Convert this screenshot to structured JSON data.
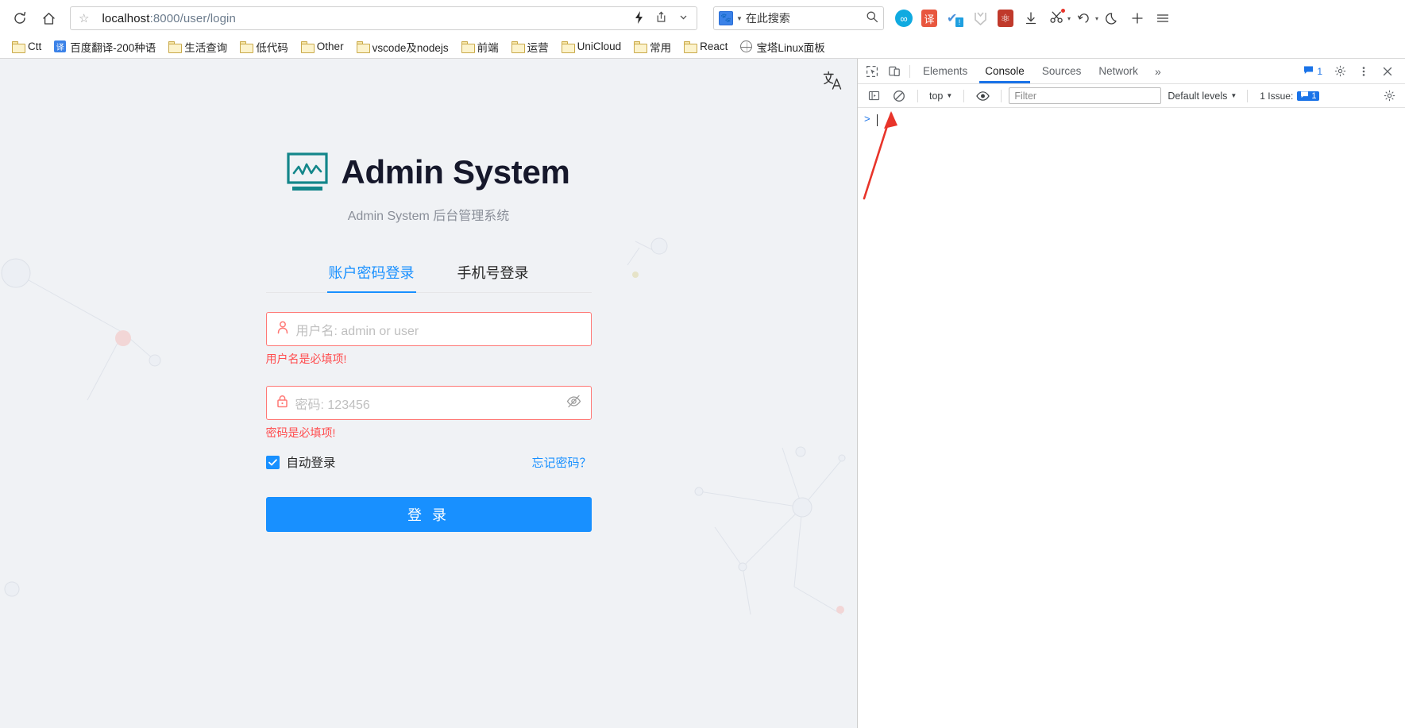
{
  "browser": {
    "nav": {
      "reload_icon": "reload-icon",
      "home_icon": "home-icon"
    },
    "omnibox": {
      "star_icon": "bookmark-star-icon",
      "url_host": "localhost",
      "url_path": ":8000/user/login",
      "lightning_icon": "lightning-icon",
      "share_icon": "share-icon",
      "chevron_icon": "chevron-down-icon"
    },
    "search": {
      "engine_icon": "baidu-paw-icon",
      "placeholder": "在此搜索",
      "search_icon": "search-icon"
    },
    "toolbar_icons": [
      {
        "name": "infinity-extension-icon",
        "glyph": "∞",
        "color": "#1aa3e8"
      },
      {
        "name": "translate-extension-icon",
        "glyph": "译",
        "color": "#e8573f"
      },
      {
        "name": "check-extension-icon",
        "glyph": "✔",
        "color": "#4a90d9"
      },
      {
        "name": "download-manager-icon",
        "glyph": "M",
        "color": "#bdbdbd"
      },
      {
        "name": "atom-extension-icon",
        "glyph": "⚛",
        "color": "#c0392b"
      },
      {
        "name": "downloads-icon",
        "glyph": "↓",
        "color": "#444"
      },
      {
        "name": "screenshot-scissors-icon",
        "glyph": "✂",
        "color": "#444"
      },
      {
        "name": "history-back-icon",
        "glyph": "↺",
        "color": "#444"
      },
      {
        "name": "dark-mode-moon-icon",
        "glyph": "☾",
        "color": "#444"
      },
      {
        "name": "new-tab-plus-icon",
        "glyph": "+",
        "color": "#444"
      },
      {
        "name": "main-menu-icon",
        "glyph": "☰",
        "color": "#444"
      }
    ],
    "bookmarks": [
      {
        "label": "Ctt",
        "icon": "folder-icon"
      },
      {
        "label": "百度翻译-200种语",
        "icon": "translate-favicon"
      },
      {
        "label": "生活查询",
        "icon": "folder-icon"
      },
      {
        "label": "低代码",
        "icon": "folder-icon"
      },
      {
        "label": "Other",
        "icon": "folder-icon"
      },
      {
        "label": "vscode及nodejs",
        "icon": "folder-icon"
      },
      {
        "label": "前端",
        "icon": "folder-icon"
      },
      {
        "label": "运营",
        "icon": "folder-icon"
      },
      {
        "label": "UniCloud",
        "icon": "folder-icon"
      },
      {
        "label": "常用",
        "icon": "folder-icon"
      },
      {
        "label": "React",
        "icon": "folder-icon"
      },
      {
        "label": "宝塔Linux面板",
        "icon": "globe-favicon"
      }
    ]
  },
  "page": {
    "translate_icon": "translate-page-icon",
    "brand": {
      "logo_icon": "monitor-chart-logo-icon",
      "title": "Admin System",
      "description": "Admin System 后台管理系统"
    },
    "tabs": [
      {
        "label": "账户密码登录",
        "active": true
      },
      {
        "label": "手机号登录",
        "active": false
      }
    ],
    "form": {
      "username": {
        "icon": "user-icon",
        "placeholder": "用户名: admin or user",
        "value": "",
        "error": "用户名是必填项!"
      },
      "password": {
        "icon": "lock-icon",
        "placeholder": "密码: 123456",
        "value": "",
        "error": "密码是必填项!",
        "toggle_icon": "eye-slash-icon"
      },
      "auto_login_label": "自动登录",
      "auto_login_checked": true,
      "forgot_label": "忘记密码？",
      "submit_label": "登 录"
    },
    "colors": {
      "primary": "#1890ff",
      "error": "#ff4d4f",
      "logo": "#13868a",
      "background": "#f0f2f5"
    }
  },
  "devtools": {
    "inspect_icon": "inspect-element-icon",
    "device_icon": "toggle-device-toolbar-icon",
    "tabs": [
      {
        "label": "Elements",
        "active": false
      },
      {
        "label": "Console",
        "active": true
      },
      {
        "label": "Sources",
        "active": false
      },
      {
        "label": "Network",
        "active": false
      }
    ],
    "more_tabs_icon": "chevron-double-right-icon",
    "messages_count": "1",
    "settings_icon": "gear-icon",
    "more_options_icon": "kebab-menu-icon",
    "close_icon": "close-icon",
    "console": {
      "sidebar_icon": "console-sidebar-icon",
      "clear_icon": "clear-console-icon",
      "context": "top",
      "context_caret": "chevron-down-icon",
      "eye_icon": "live-expression-eye-icon",
      "filter_placeholder": "Filter",
      "levels_label": "Default levels",
      "levels_caret": "chevron-down-icon",
      "issues_label": "1 Issue:",
      "issues_count": "1",
      "console_settings_icon": "gear-icon",
      "prompt_symbol": ">"
    }
  },
  "annotation": {
    "arrow_name": "red-pointer-arrow",
    "color": "#e8342a",
    "points_to": "clear-console-icon"
  }
}
